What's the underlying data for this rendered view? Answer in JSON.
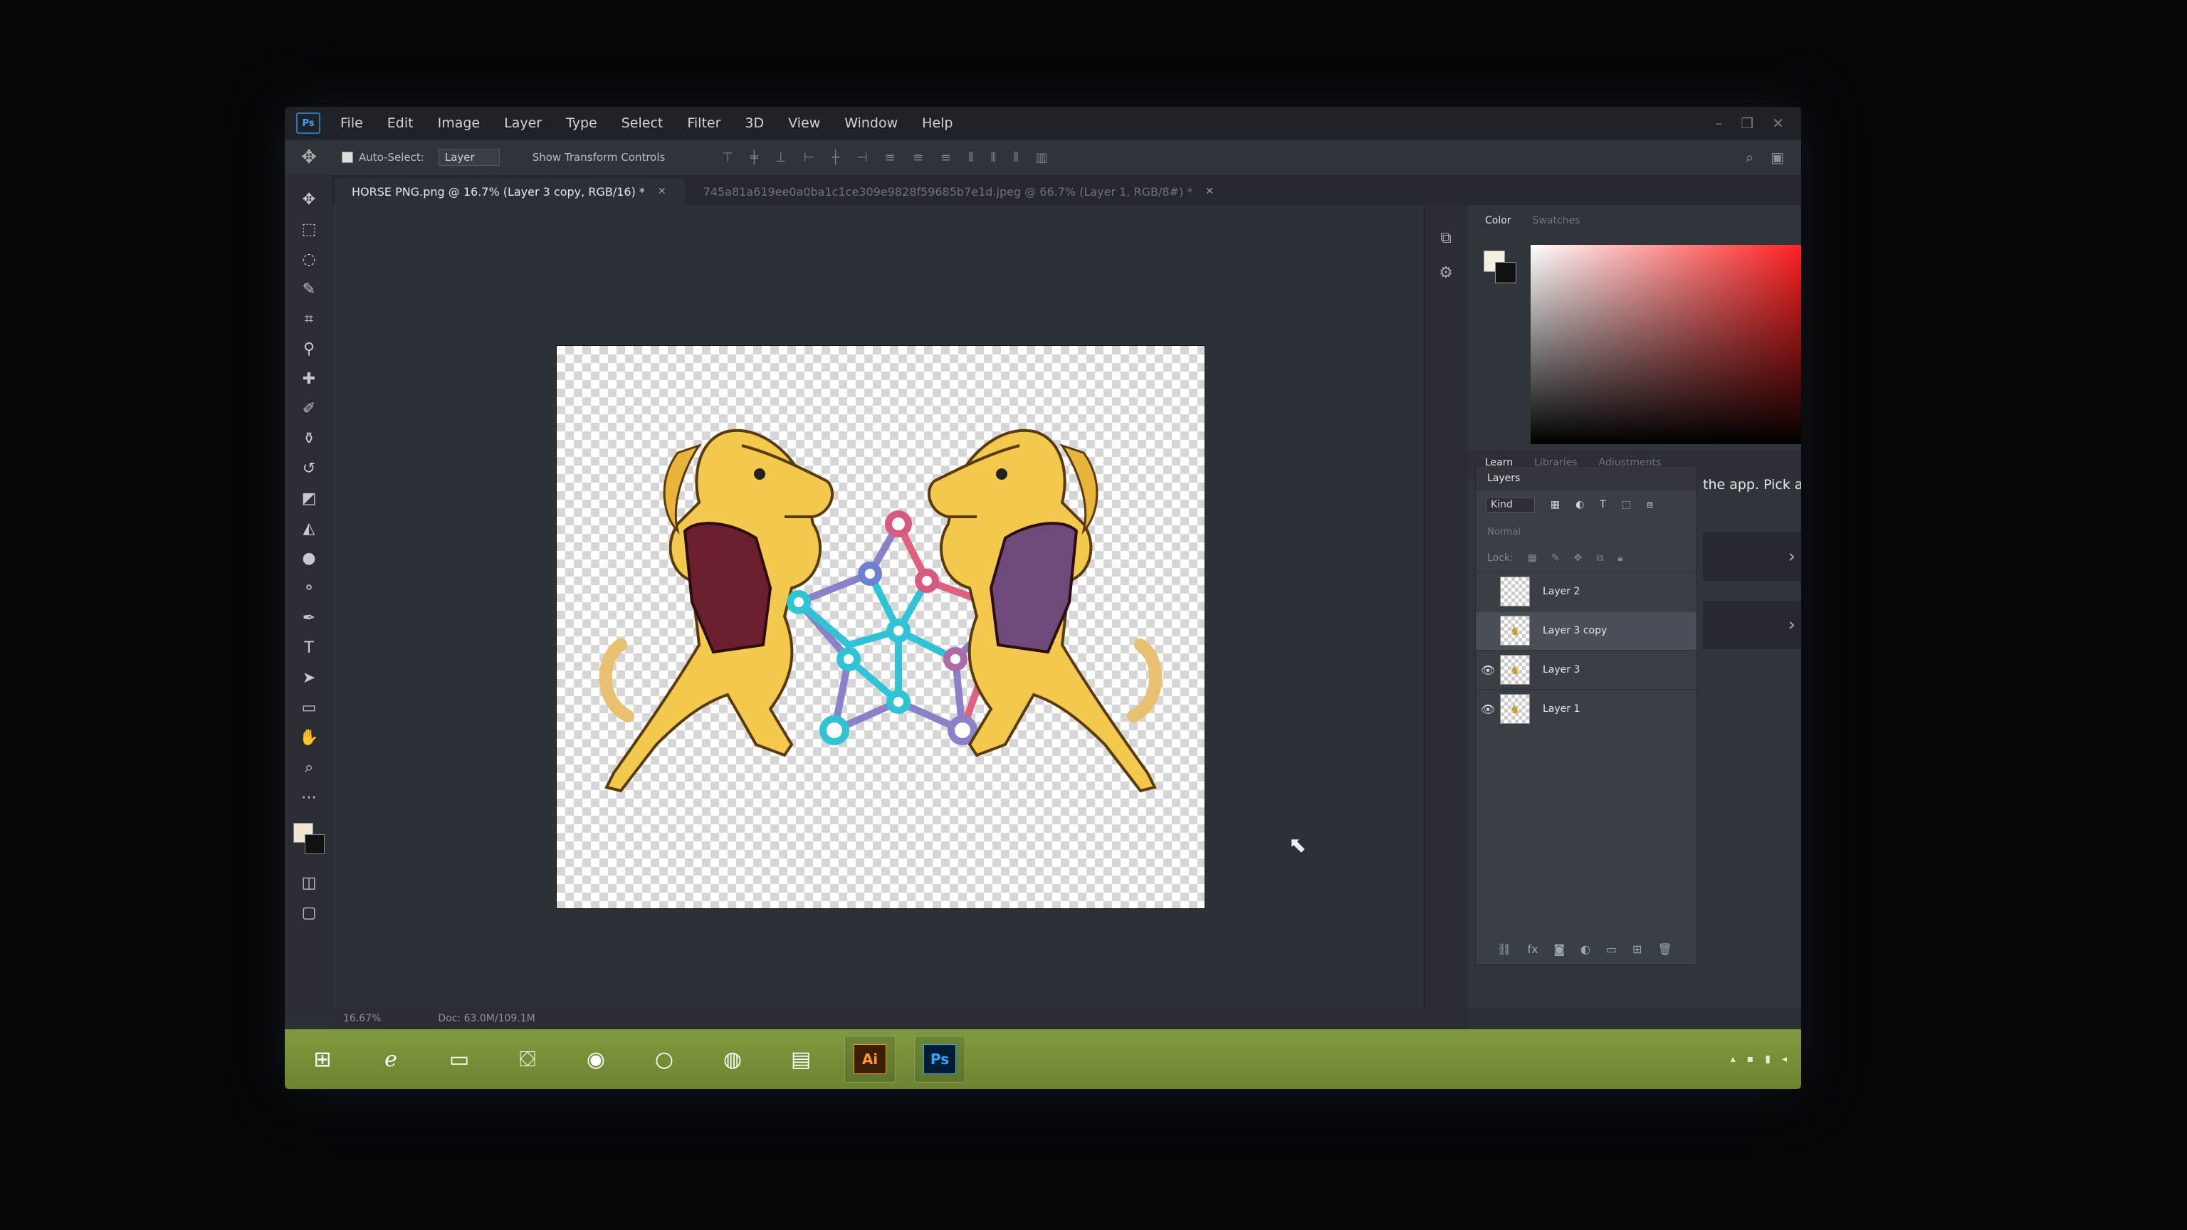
{
  "menu": {
    "items": [
      "File",
      "Edit",
      "Image",
      "Layer",
      "Type",
      "Select",
      "Filter",
      "3D",
      "View",
      "Window",
      "Help"
    ]
  },
  "options": {
    "auto_select_label": "Auto-Select:",
    "auto_select_target": "Layer",
    "transform_label": "Show Transform Controls"
  },
  "tabs": {
    "active": "HORSE PNG.png @ 16.7% (Layer 3 copy, RGB/16) *",
    "inactive": "745a81a619ee0a0ba1c1ce309e9828f59685b7e1d.jpeg @ 66.7% (Layer 1, RGB/8#) *"
  },
  "color_panel": {
    "tabs": [
      "Color",
      "Swatches"
    ],
    "foreground": "#f5efe1",
    "background": "#111111"
  },
  "learn_panel": {
    "tabs": [
      "Learn",
      "Libraries",
      "Adjustments"
    ],
    "text": "the app. Pick a"
  },
  "layers_panel": {
    "title": "Layers",
    "filter_kind": "Kind",
    "blend_mode": "Normal",
    "lock_label": "Lock:",
    "layers": [
      {
        "name": "Layer 2",
        "visible": false,
        "selected": false
      },
      {
        "name": "Layer 3 copy",
        "visible": false,
        "selected": true
      },
      {
        "name": "Layer 3",
        "visible": true,
        "selected": false
      },
      {
        "name": "Layer 1",
        "visible": true,
        "selected": false
      }
    ]
  },
  "status": {
    "zoom": "16.67%",
    "doc": "Doc: 63.0M/109.1M"
  },
  "taskbar": {
    "apps": [
      "start",
      "internet-explorer",
      "file-explorer",
      "store",
      "chrome",
      "opera",
      "firefox",
      "folder",
      "illustrator",
      "photoshop"
    ],
    "illustrator_label": "Ai",
    "photoshop_label": "Ps"
  },
  "colors": {
    "accent_blue": "#31a8ff",
    "taskbar_green": "#7f9a3e",
    "horse_yellow": "#f2c94c",
    "vest": "#6b1f2e",
    "network_cyan": "#2ec4d6",
    "network_pink": "#e0607e"
  }
}
